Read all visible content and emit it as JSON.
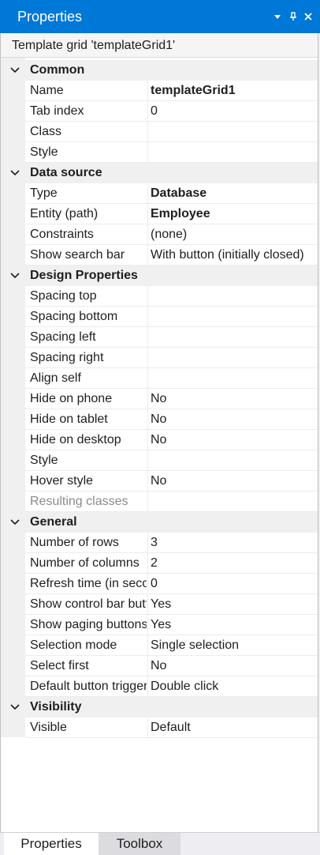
{
  "panel": {
    "title": "Properties",
    "subtitle": "Template grid 'templateGrid1'"
  },
  "categories": [
    {
      "label": "Common",
      "rows": [
        {
          "name": "Name",
          "value": "templateGrid1",
          "bold": true
        },
        {
          "name": "Tab index",
          "value": "0"
        },
        {
          "name": "Class",
          "value": ""
        },
        {
          "name": "Style",
          "value": ""
        }
      ]
    },
    {
      "label": "Data source",
      "rows": [
        {
          "name": "Type",
          "value": "Database",
          "bold": true
        },
        {
          "name": "Entity (path)",
          "value": "Employee",
          "bold": true
        },
        {
          "name": "Constraints",
          "value": "(none)"
        },
        {
          "name": "Show search bar",
          "value": "With button (initially closed)"
        }
      ]
    },
    {
      "label": "Design Properties",
      "rows": [
        {
          "name": "Spacing top",
          "value": ""
        },
        {
          "name": "Spacing bottom",
          "value": ""
        },
        {
          "name": "Spacing left",
          "value": ""
        },
        {
          "name": "Spacing right",
          "value": ""
        },
        {
          "name": "Align self",
          "value": ""
        },
        {
          "name": "Hide on phone",
          "value": "No"
        },
        {
          "name": "Hide on tablet",
          "value": "No"
        },
        {
          "name": "Hide on desktop",
          "value": "No"
        },
        {
          "name": "Style",
          "value": ""
        },
        {
          "name": "Hover style",
          "value": "No"
        },
        {
          "name": "Resulting classes",
          "value": "",
          "disabled": true
        }
      ]
    },
    {
      "label": "General",
      "rows": [
        {
          "name": "Number of rows",
          "value": "3"
        },
        {
          "name": "Number of columns",
          "value": "2"
        },
        {
          "name": "Refresh time (in seconds)",
          "value": "0"
        },
        {
          "name": "Show control bar buttons",
          "value": "Yes"
        },
        {
          "name": "Show paging buttons",
          "value": "Yes"
        },
        {
          "name": "Selection mode",
          "value": "Single selection"
        },
        {
          "name": "Select first",
          "value": "No"
        },
        {
          "name": "Default button trigger",
          "value": "Double click"
        }
      ]
    },
    {
      "label": "Visibility",
      "rows": [
        {
          "name": "Visible",
          "value": "Default"
        }
      ]
    }
  ],
  "tabs": [
    {
      "label": "Properties",
      "active": true
    },
    {
      "label": "Toolbox",
      "active": false
    }
  ],
  "icons": {
    "dropdown": "triangle-down-icon",
    "pin": "pin-icon",
    "close": "close-icon",
    "chevron": "chevron-down-icon"
  },
  "colors": {
    "titlebar": "#0078d7",
    "gutter": "#f0f0f0",
    "disabled_text": "#8a8a8a"
  }
}
